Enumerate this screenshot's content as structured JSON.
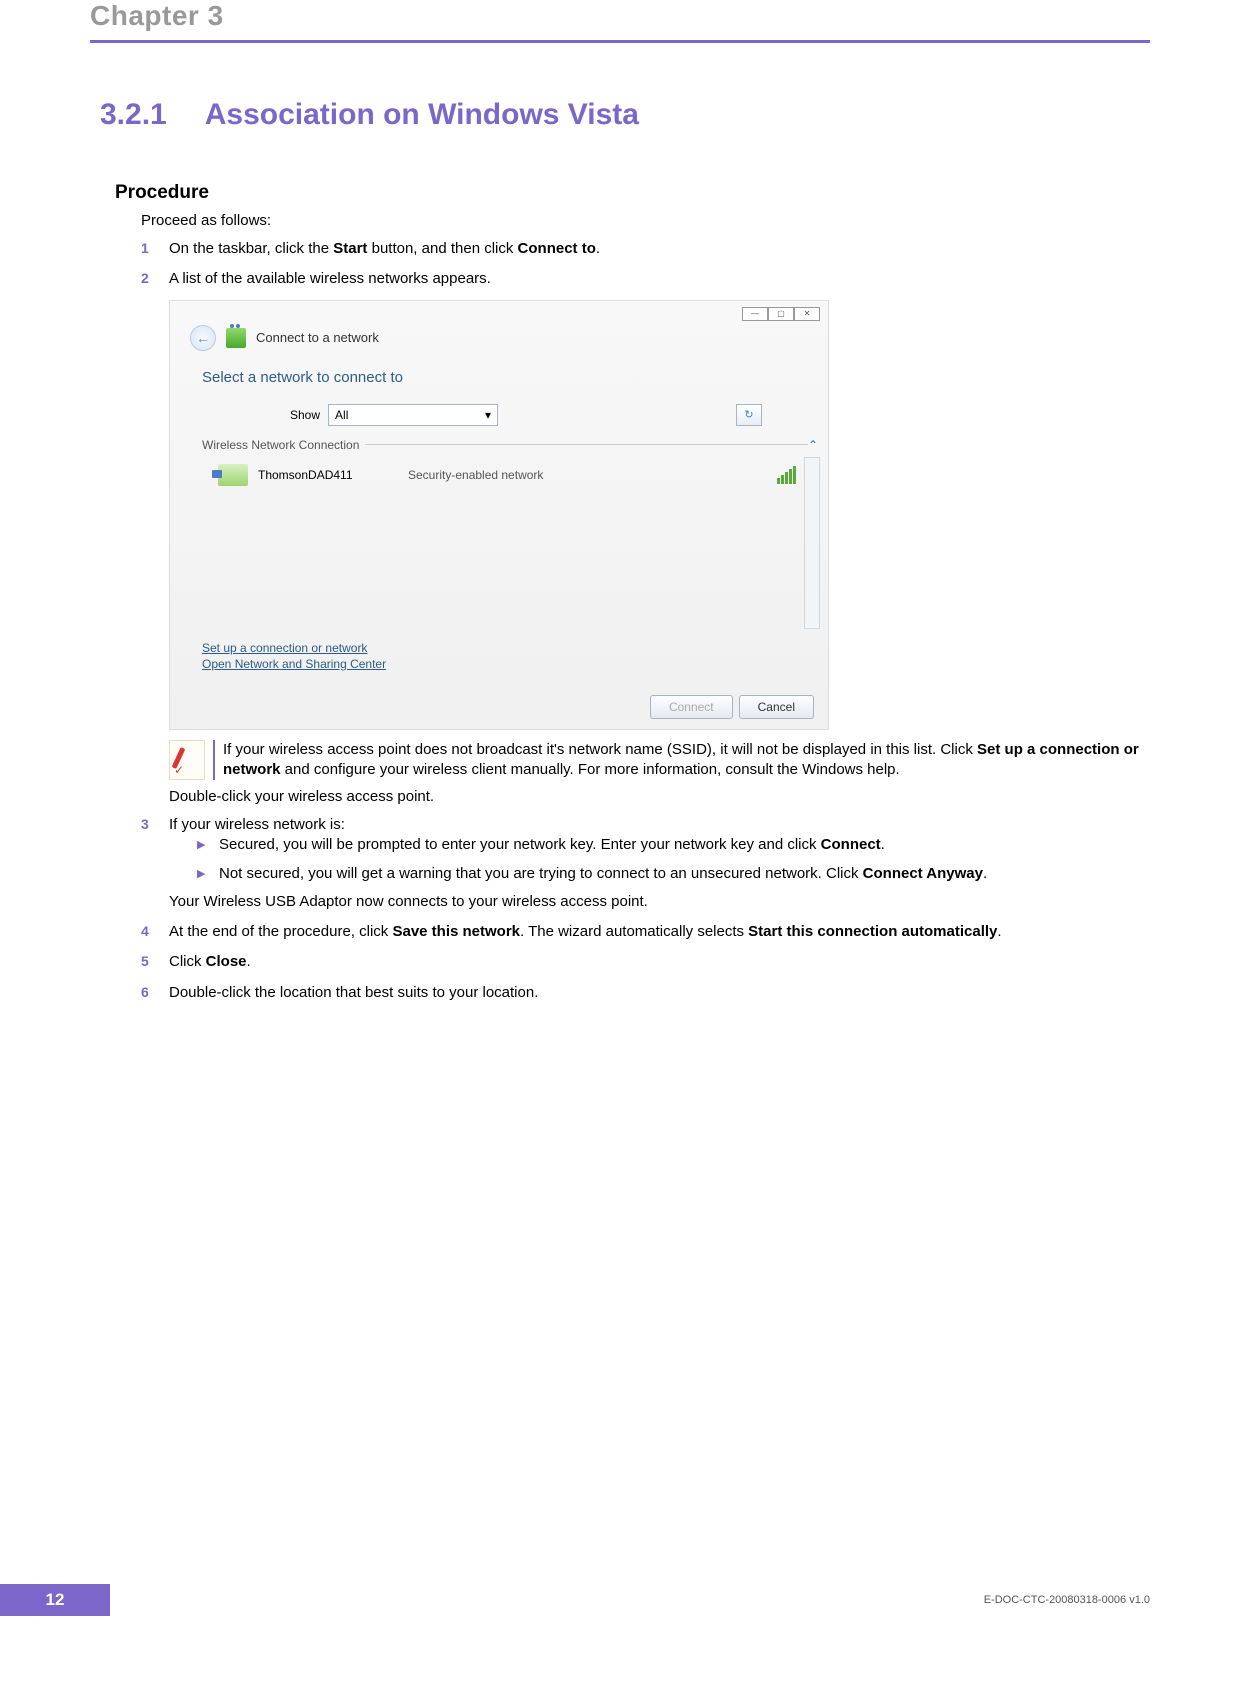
{
  "header": {
    "chapter": "Chapter 3"
  },
  "section": {
    "number": "3.2.1",
    "title": "Association on Windows Vista"
  },
  "procedure": {
    "label": "Procedure",
    "intro": "Proceed as follows:",
    "steps": [
      {
        "num": "1",
        "text_before": "On the taskbar, click the ",
        "bold1": "Start",
        "mid": " button, and then click ",
        "bold2": "Connect to",
        "after": "."
      },
      {
        "num": "2",
        "text": "A list of the available wireless networks appears."
      }
    ],
    "note": {
      "part1": "If your wireless access point does not broadcast it's network name (SSID), it will not be displayed in this list. Click ",
      "bold": "Set up a connection or network",
      "part2": " and configure your wireless client manually. For more information, consult the Windows help."
    },
    "after_note": "Double-click your wireless access point.",
    "step3": {
      "num": "3",
      "lead": "If your wireless network is:",
      "bullets": [
        {
          "pre": "Secured, you will be prompted to enter your network key. Enter your network key and click ",
          "bold": "Connect",
          "post": "."
        },
        {
          "pre": "Not secured, you will get a warning that you are trying to connect to an unsecured network. Click ",
          "bold": "Connect Anyway",
          "post": "."
        }
      ],
      "tail": "Your Wireless USB Adaptor now connects to your wireless access point."
    },
    "step4": {
      "num": "4",
      "pre": "At the end of the procedure, click ",
      "bold1": "Save this network",
      "mid": ". The wizard automatically selects ",
      "bold2": "Start this connection automatically",
      "post": "."
    },
    "step5": {
      "num": "5",
      "pre": "Click ",
      "bold": "Close",
      "post": "."
    },
    "step6": {
      "num": "6",
      "text": "Double-click the location that best suits to your location."
    }
  },
  "screenshot": {
    "window_title": "Connect to a network",
    "heading": "Select a network to connect to",
    "show_label": "Show",
    "show_value": "All",
    "group": "Wireless Network Connection",
    "network": {
      "name": "ThomsonDAD411",
      "desc": "Security-enabled network"
    },
    "link1": "Set up a connection or network",
    "link2": "Open Network and Sharing Center",
    "btn_connect": "Connect",
    "btn_cancel": "Cancel"
  },
  "footer": {
    "page": "12",
    "docid": "E-DOC-CTC-20080318-0006 v1.0"
  }
}
